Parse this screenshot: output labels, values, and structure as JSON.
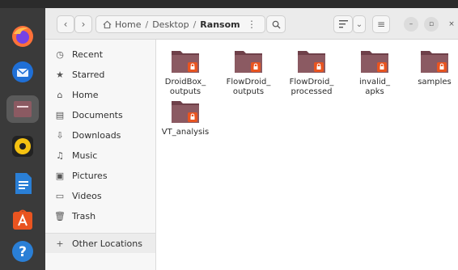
{
  "header": {
    "back_icon": "‹",
    "forward_icon": "›",
    "path": [
      "Home",
      "Desktop",
      "Ransom"
    ],
    "path_separator": "/",
    "menu_icon": "⋮",
    "search_icon": "search",
    "view_icon": "list",
    "dropdown_icon": "⌄",
    "hamburger_icon": "≡",
    "minimize_icon": "–",
    "maximize_icon": "▫",
    "close_icon": "×"
  },
  "sidebar": {
    "items": [
      {
        "label": "Recent",
        "icon": "◷"
      },
      {
        "label": "Starred",
        "icon": "★"
      },
      {
        "label": "Home",
        "icon": "⌂"
      },
      {
        "label": "Documents",
        "icon": "▤"
      },
      {
        "label": "Downloads",
        "icon": "⇩"
      },
      {
        "label": "Music",
        "icon": "♫"
      },
      {
        "label": "Pictures",
        "icon": "▣"
      },
      {
        "label": "Videos",
        "icon": "▭"
      },
      {
        "label": "Trash",
        "icon": "🗑"
      }
    ],
    "other_locations": {
      "label": "Other Locations",
      "icon": "+"
    }
  },
  "files": [
    {
      "label": "DroidBox_\noutputs",
      "locked": true
    },
    {
      "label": "FlowDroid_\noutputs",
      "locked": true
    },
    {
      "label": "FlowDroid_\nprocessed",
      "locked": true
    },
    {
      "label": "invalid_\napks",
      "locked": true
    },
    {
      "label": "samples",
      "locked": true
    },
    {
      "label": "VT_analysis",
      "locked": true
    }
  ],
  "colors": {
    "folder_body": "#8b5a62",
    "folder_tab": "#6f4049",
    "lock_badge": "#e95420",
    "dock_bg": "#3a3a3a"
  }
}
